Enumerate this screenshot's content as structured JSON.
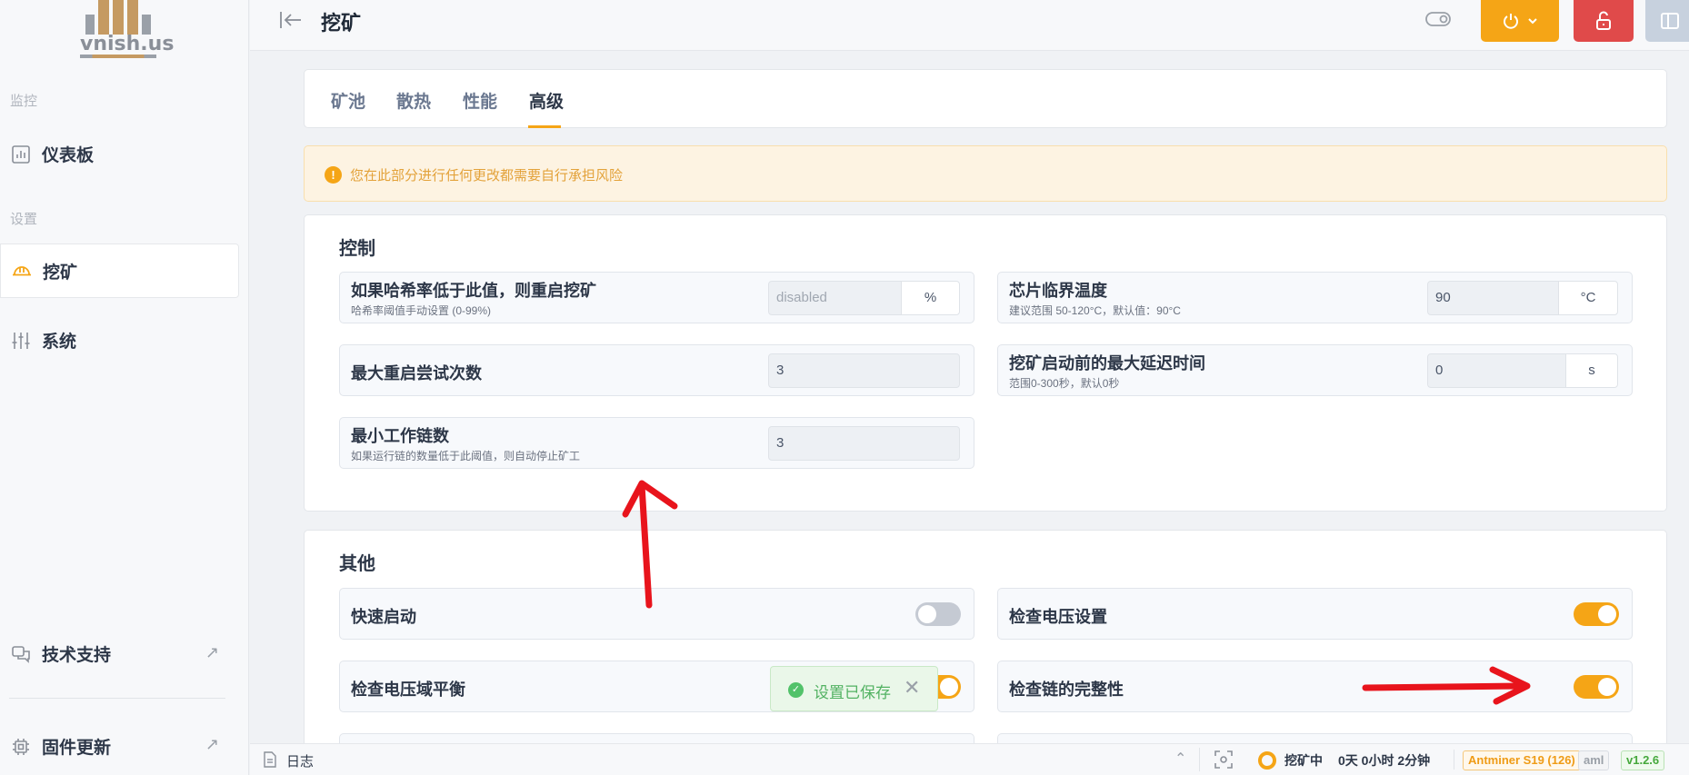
{
  "brand": {
    "logo_text": "vnish.us"
  },
  "sidebar": {
    "section_monitor": "监控",
    "dashboard": "仪表板",
    "section_settings": "设置",
    "mining": "挖矿",
    "system": "系统",
    "support": "技术支持",
    "firmware": "固件更新"
  },
  "header": {
    "title": "挖矿"
  },
  "tabs": [
    {
      "label": "矿池"
    },
    {
      "label": "散热"
    },
    {
      "label": "性能"
    },
    {
      "label": "高级"
    }
  ],
  "warning": {
    "text": "您在此部分进行任何更改都需要自行承担风险"
  },
  "control": {
    "title": "控制",
    "hashrate_restart": {
      "label": "如果哈希率低于此值，则重启挖矿",
      "hint": "哈希率阈值手动设置 (0-99%)",
      "value": "disabled",
      "unit": "%"
    },
    "chip_temp": {
      "label": "芯片临界温度",
      "hint": "建议范围 50-120°C，默认值：90°C",
      "value": "90",
      "unit": "°C"
    },
    "max_restarts": {
      "label": "最大重启尝试次数",
      "value": "3"
    },
    "start_delay": {
      "label": "挖矿启动前的最大延迟时间",
      "hint": "范围0-300秒，默认0秒",
      "value": "0",
      "unit": "s"
    },
    "min_chains": {
      "label": "最小工作链数",
      "hint": "如果运行链的数量低于此阈值，则自动停止矿工",
      "value": "3"
    }
  },
  "other": {
    "title": "其他",
    "quick_start": {
      "label": "快速启动",
      "on": false
    },
    "check_voltage": {
      "label": "检查电压设置",
      "on": true
    },
    "voltage_balance": {
      "label": "检查电压域平衡",
      "on": true
    },
    "chain_integrity": {
      "label": "检查链的完整性",
      "on": true
    }
  },
  "toast": {
    "text": "设置已保存"
  },
  "footer": {
    "log": "日志",
    "status": "挖矿中",
    "uptime": "0天 0小时 2分钟",
    "model": "Antminer S19 (126)",
    "aml": "aml",
    "version": "v1.2.6"
  },
  "colors": {
    "accent": "#f5a516",
    "danger": "#e04a4a",
    "success": "#52c26a",
    "annotation": "#e8141c"
  }
}
